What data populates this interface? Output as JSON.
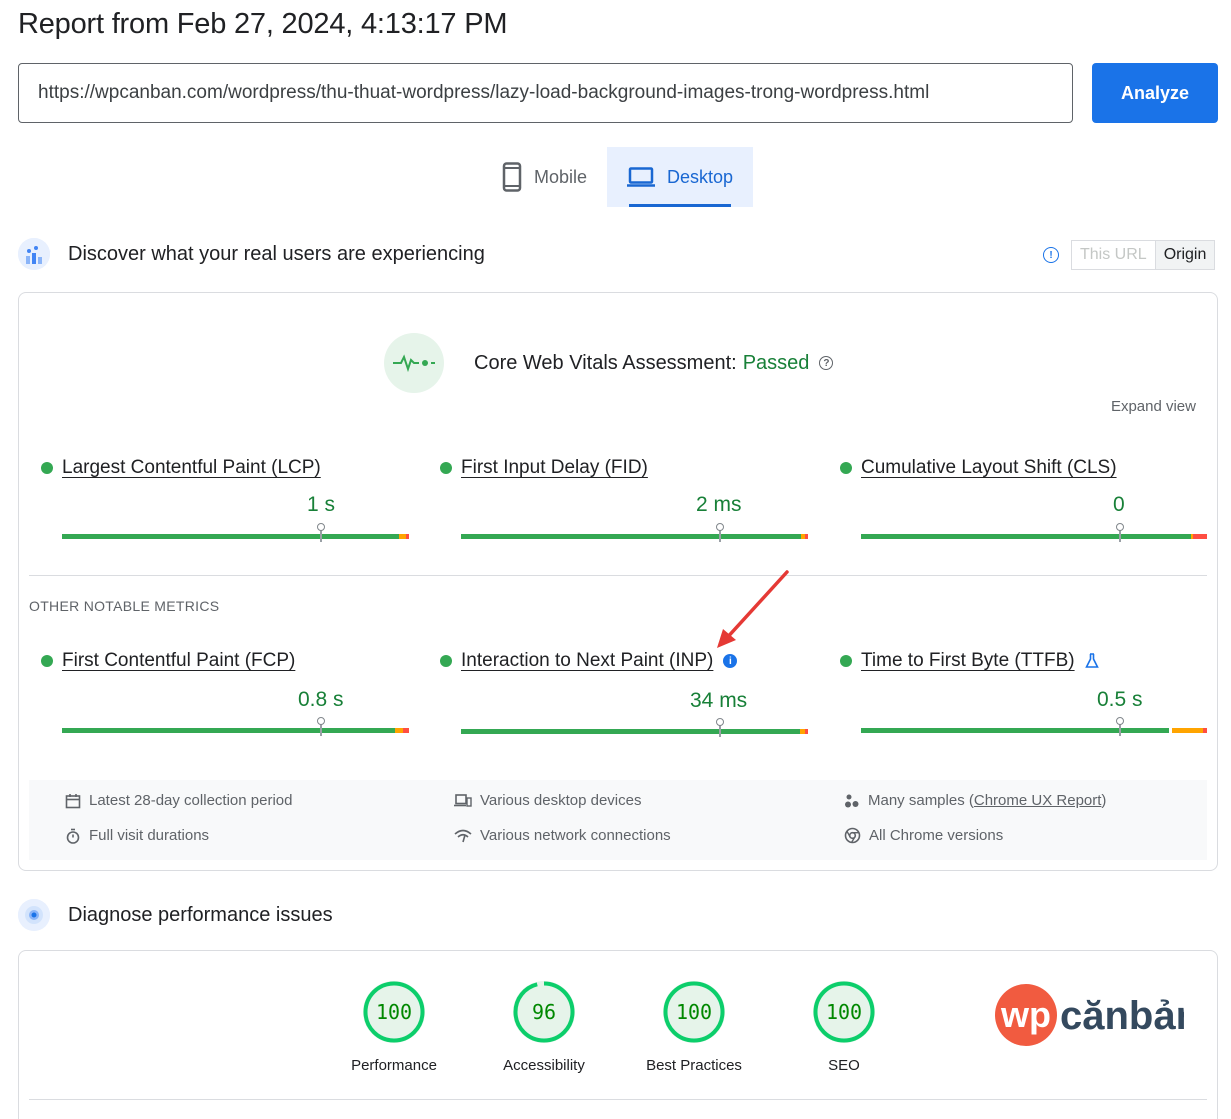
{
  "report": {
    "title": "Report from Feb 27, 2024, 4:13:17 PM"
  },
  "search": {
    "url": "https://wpcanban.com/wordpress/thu-thuat-wordpress/lazy-load-background-images-trong-wordpress.html",
    "analyze_label": "Analyze"
  },
  "tabs": [
    {
      "label": "Mobile",
      "icon": "phone-icon",
      "active": false
    },
    {
      "label": "Desktop",
      "icon": "laptop-icon",
      "active": true
    }
  ],
  "field_section": {
    "title": "Discover what your real users are experiencing",
    "toggle": {
      "this_url": "This URL",
      "origin": "Origin",
      "selected": "Origin"
    },
    "assessment_label": "Core Web Vitals Assessment:",
    "assessment_status": "Passed",
    "expand_view": "Expand view",
    "core_metrics": [
      {
        "name": "Largest Contentful Paint (LCP)",
        "value": "1 s",
        "status": "good"
      },
      {
        "name": "First Input Delay (FID)",
        "value": "2 ms",
        "status": "good"
      },
      {
        "name": "Cumulative Layout Shift (CLS)",
        "value": "0",
        "status": "good"
      }
    ],
    "other_label": "OTHER NOTABLE METRICS",
    "other_metrics": [
      {
        "name": "First Contentful Paint (FCP)",
        "value": "0.8 s",
        "status": "good"
      },
      {
        "name": "Interaction to Next Paint (INP)",
        "value": "34 ms",
        "status": "good",
        "badge": "info-icon"
      },
      {
        "name": "Time to First Byte (TTFB)",
        "value": "0.5 s",
        "status": "good",
        "badge": "flask-icon"
      }
    ],
    "meta": {
      "collection_period": "Latest 28-day collection period",
      "visit_durations": "Full visit durations",
      "devices": "Various desktop devices",
      "network": "Various network connections",
      "samples_prefix": "Many samples (",
      "samples_link": "Chrome UX Report",
      "samples_suffix": ")",
      "chrome_versions": "All Chrome versions"
    }
  },
  "diagnose_section": {
    "title": "Diagnose performance issues",
    "scores": [
      {
        "label": "Performance",
        "score": "100"
      },
      {
        "label": "Accessibility",
        "score": "96"
      },
      {
        "label": "Best Practices",
        "score": "100"
      },
      {
        "label": "SEO",
        "score": "100"
      }
    ]
  },
  "logo": {
    "text_wp": "wp",
    "text_rest": "cănbản"
  },
  "colors": {
    "good": "#34a853",
    "good_text": "#188038",
    "average": "#ffa400",
    "poor": "#ff4e42",
    "primary": "#1a73e8",
    "logo_red": "#f15b40",
    "logo_dark": "#34495e"
  }
}
